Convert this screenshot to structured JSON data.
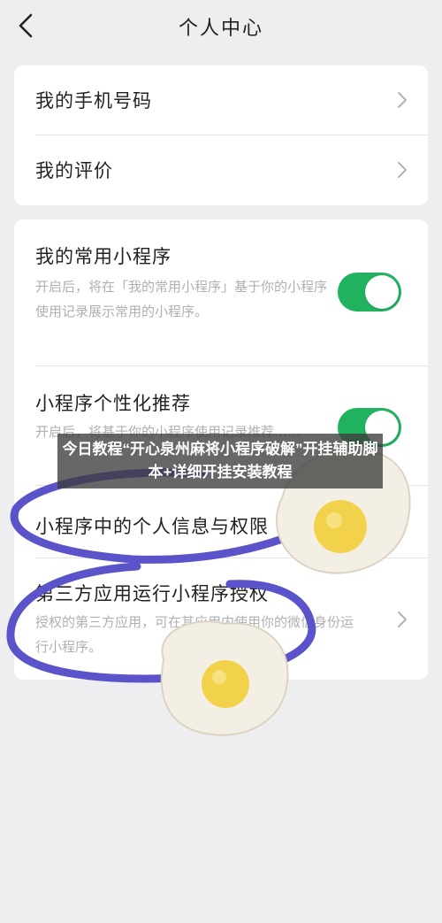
{
  "header": {
    "title": "个人中心",
    "back_icon": "chevron-left-icon"
  },
  "account_section": {
    "items": [
      {
        "label": "我的手机号码"
      },
      {
        "label": "我的评价"
      }
    ]
  },
  "miniprogram_section": {
    "common": {
      "title": "我的常用小程序",
      "desc": "开启后，将在「我的常用小程序」基于你的小程序使用记录展示常用的小程序。",
      "toggle_on": true
    },
    "personalized": {
      "title": "小程序个性化推荐",
      "desc": "开启后，将基于你的小程序使用记录推荐……",
      "toggle_on": true
    },
    "personal_info": {
      "title": "小程序中的个人信息与权限"
    },
    "third_party": {
      "title": "第三方应用运行小程序授权",
      "desc": "授权的第三方应用，可在其应用内使用你的微信身份运行小程序。"
    }
  },
  "overlay": {
    "caption": "今日教程“开心泉州麻将小程序破解”开挂辅助脚本+详细开挂安装教程"
  },
  "colors": {
    "toggle_on": "#20b25e",
    "scribble": "#5a53c9",
    "background": "#eeeef1"
  }
}
